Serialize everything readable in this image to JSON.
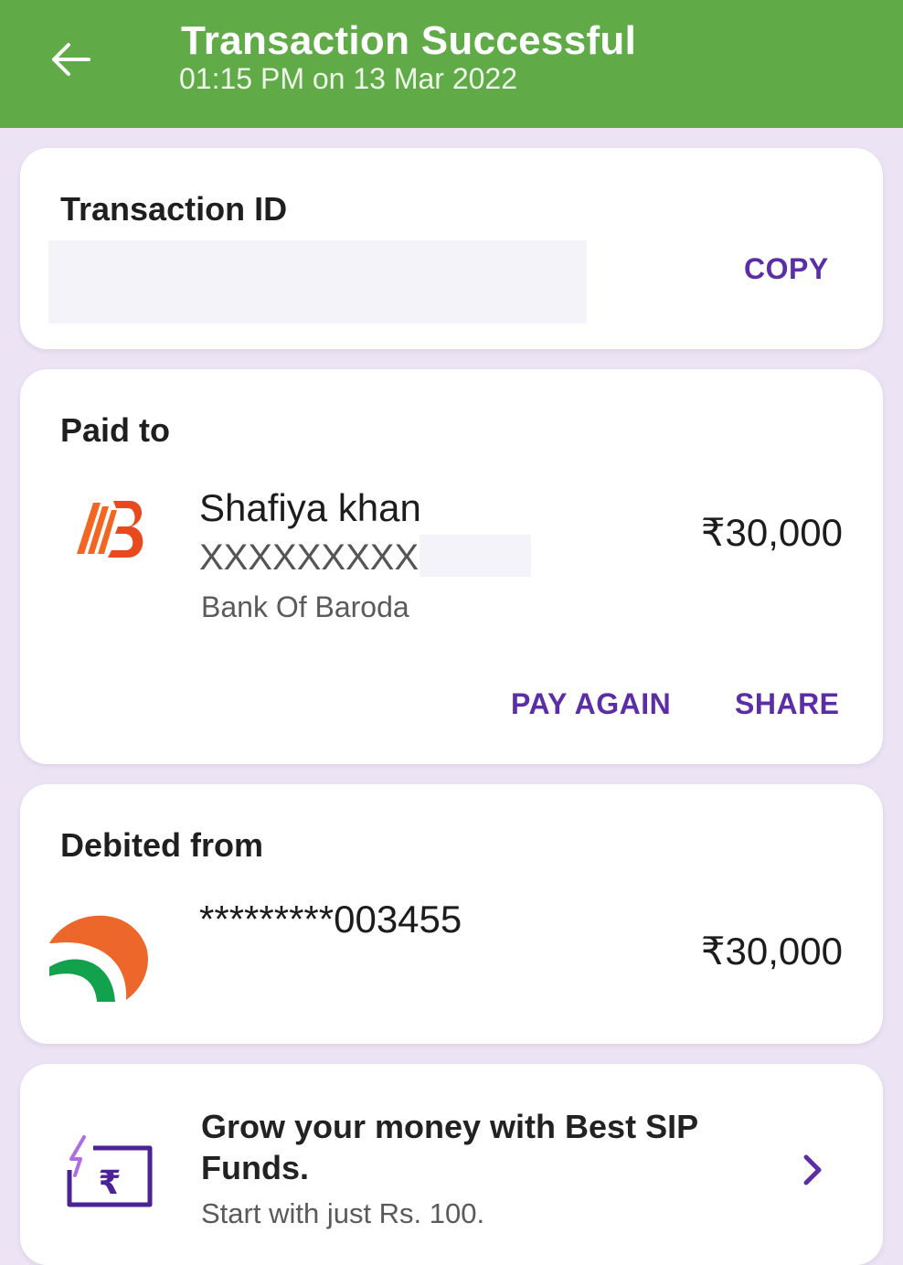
{
  "header": {
    "title": "Transaction Successful",
    "subtitle": "01:15 PM on 13 Mar 2022",
    "back_icon": "arrow-left-icon"
  },
  "transaction_card": {
    "title": "Transaction ID",
    "copy_label": "COPY"
  },
  "paid_to_card": {
    "title": "Paid to",
    "payee_name": "Shafiya khan",
    "account_masked": "XXXXXXXXXX",
    "bank_name": "Bank Of Baroda",
    "amount": "₹30,000",
    "pay_again_label": "PAY AGAIN",
    "share_label": "SHARE",
    "bank_icon": "bank-of-baroda-logo"
  },
  "debited_card": {
    "title": "Debited from",
    "account_masked": "*********003455",
    "amount": "₹30,000",
    "bank_icon": "bank-logo"
  },
  "promo_card": {
    "title": "Grow your money with Best SIP Funds.",
    "subtitle": "Start with just Rs. 100.",
    "icon": "rupee-wallet-icon",
    "chevron_icon": "chevron-right-icon"
  },
  "colors": {
    "header_green": "#60aa48",
    "accent_purple": "#5b2ea6",
    "background": "#ece4f5"
  }
}
